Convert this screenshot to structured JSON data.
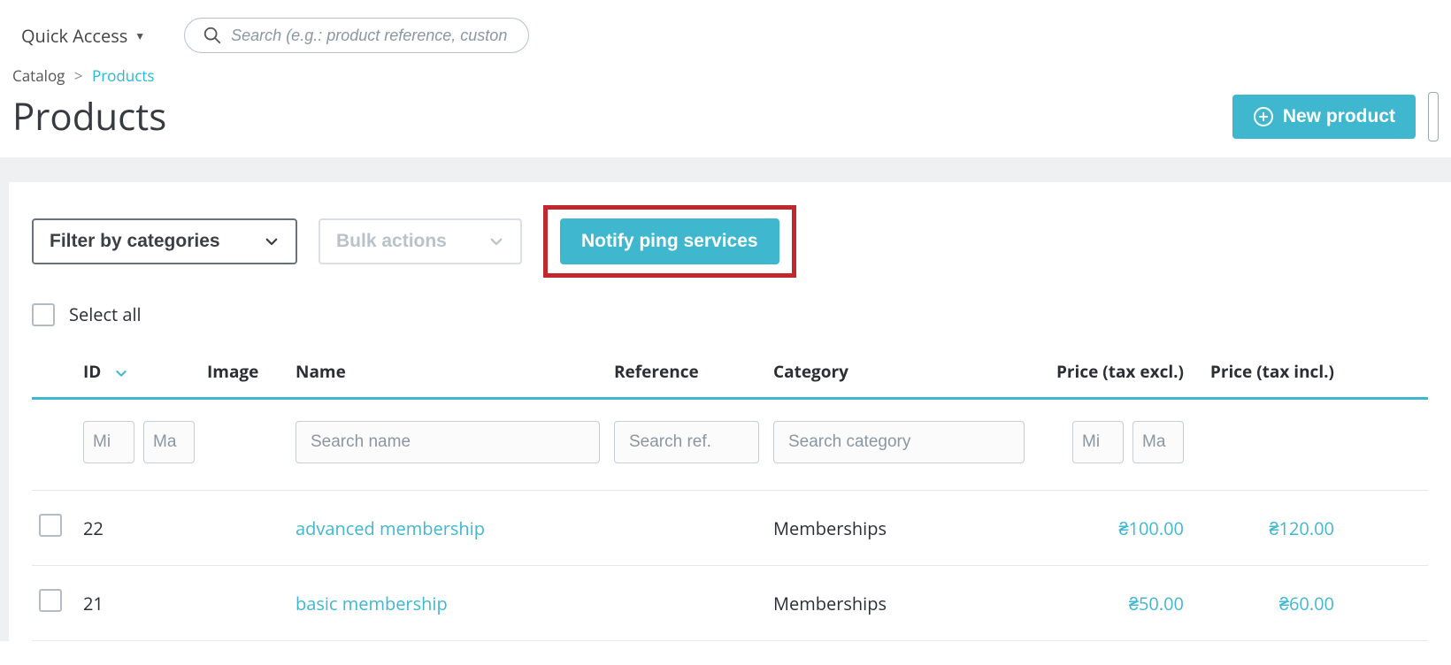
{
  "topbar": {
    "quick_access": "Quick Access",
    "search_placeholder": "Search (e.g.: product reference, custon"
  },
  "breadcrumb": {
    "root": "Catalog",
    "sep": ">",
    "current": "Products"
  },
  "page_title": "Products",
  "actions": {
    "new_product": "New product"
  },
  "toolbar": {
    "filter_by_categories": "Filter by categories",
    "bulk_actions": "Bulk actions",
    "notify_ping": "Notify ping services"
  },
  "select_all_label": "Select all",
  "columns": {
    "id": "ID",
    "image": "Image",
    "name": "Name",
    "reference": "Reference",
    "category": "Category",
    "price_excl": "Price (tax excl.)",
    "price_incl": "Price (tax incl.)"
  },
  "filters": {
    "id_min": "Mi",
    "id_max": "Ma",
    "name": "Search name",
    "reference": "Search ref.",
    "category": "Search category",
    "price_min": "Mi",
    "price_max": "Ma"
  },
  "currency": "₴",
  "rows": [
    {
      "id": "22",
      "name": "advanced membership",
      "reference": "",
      "category": "Memberships",
      "price_excl": "₴100.00",
      "price_incl": "₴120.00"
    },
    {
      "id": "21",
      "name": "basic membership",
      "reference": "",
      "category": "Memberships",
      "price_excl": "₴50.00",
      "price_incl": "₴60.00"
    }
  ]
}
